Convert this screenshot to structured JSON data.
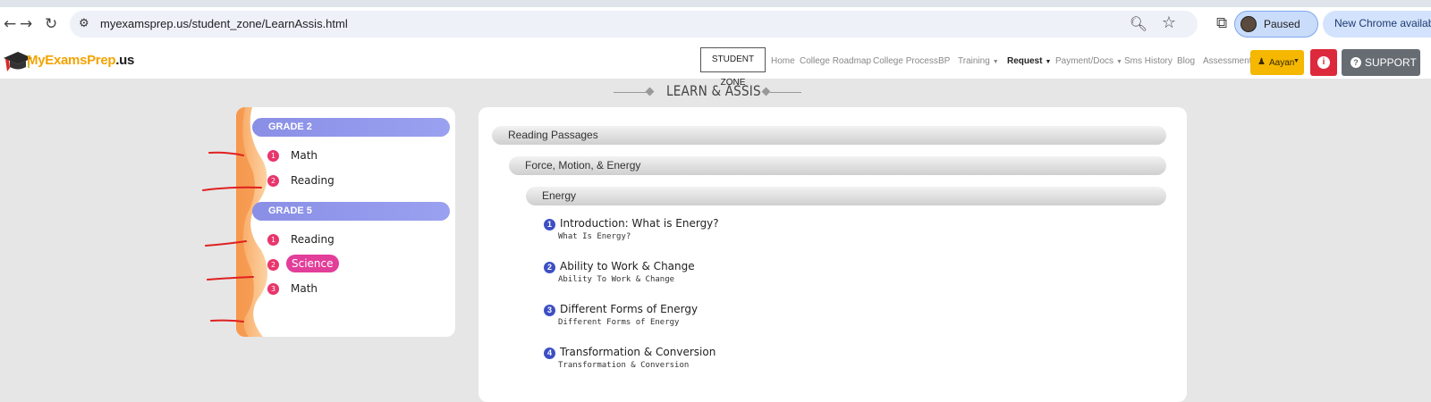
{
  "browser": {
    "url": "myexamsprep.us/student_zone/LearnAssis.html",
    "profile_status": "Paused",
    "update_label": "New Chrome available"
  },
  "site": {
    "brand_main": "MyExamsPrep",
    "brand_suffix": ".us",
    "student_zone_label": "STUDENT ZONE",
    "nav": {
      "home": "Home",
      "college_roadmap": "College Roadmap",
      "college_process": "College Process",
      "bp": "BP",
      "training": "Training",
      "request": "Request",
      "payment_docs": "Payment/Docs",
      "sms_history": "Sms History",
      "blog": "Blog",
      "assessment": "Assessment"
    },
    "user_name": "Aayan",
    "info_glyph": "i",
    "support_label": "SUPPORT"
  },
  "page": {
    "title": "LEARN & ASSIS"
  },
  "grades": [
    {
      "label": "GRADE 2",
      "subjects": [
        {
          "num": "1",
          "label": "Math"
        },
        {
          "num": "2",
          "label": "Reading"
        }
      ]
    },
    {
      "label": "GRADE 5",
      "subjects": [
        {
          "num": "1",
          "label": "Reading"
        },
        {
          "num": "2",
          "label": "Science",
          "active": true
        },
        {
          "num": "3",
          "label": "Math"
        }
      ]
    }
  ],
  "content": {
    "level1": "Reading Passages",
    "level2": "Force, Motion, & Energy",
    "level3": "Energy",
    "lessons": [
      {
        "num": "1",
        "title": "Introduction: What is Energy?",
        "subtitle": "What Is Energy?"
      },
      {
        "num": "2",
        "title": "Ability to Work & Change",
        "subtitle": "Ability To Work & Change"
      },
      {
        "num": "3",
        "title": "Different Forms of Energy",
        "subtitle": "Different Forms of Energy"
      },
      {
        "num": "4",
        "title": "Transformation & Conversion",
        "subtitle": "Transformation & Conversion"
      }
    ]
  },
  "colors": {
    "accent_pink": "#e8366c",
    "active_pill": "#e23e9a",
    "grade_header": "#8a8fe6",
    "lesson_number": "#3c4fc4",
    "user_button": "#f5b700",
    "info_button": "#dc2a3c",
    "support_button": "#666c72",
    "annotation_red": "#e02020"
  }
}
